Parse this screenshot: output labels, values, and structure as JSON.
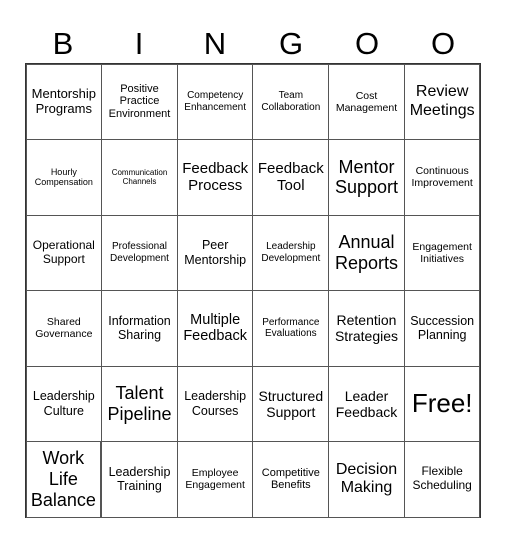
{
  "header": [
    "B",
    "I",
    "N",
    "G",
    "O",
    "O"
  ],
  "cells": [
    "Mentorship Programs",
    "Positive Practice Environment",
    "Competency Enhancement",
    "Team Collaboration",
    "Cost Management",
    "Review Meetings",
    "Hourly Compensation",
    "Communication Channels",
    "Feedback Process",
    "Feedback Tool",
    "Mentor Support",
    "Continuous Improvement",
    "Operational Support",
    "Professional Development",
    "Peer Mentorship",
    "Leadership Development",
    "Annual Reports",
    "Engagement Initiatives",
    "Shared Governance",
    "Information Sharing",
    "Multiple Feedback",
    "Performance Evaluations",
    "Retention Strategies",
    "Succession Planning",
    "Leadership Culture",
    "Talent Pipeline",
    "Leadership Courses",
    "Structured Support",
    "Leader Feedback",
    "Free!",
    "Work Life Balance",
    "Leadership Training",
    "Employee Engagement",
    "Competitive Benefits",
    "Decision Making",
    "Flexible Scheduling"
  ]
}
